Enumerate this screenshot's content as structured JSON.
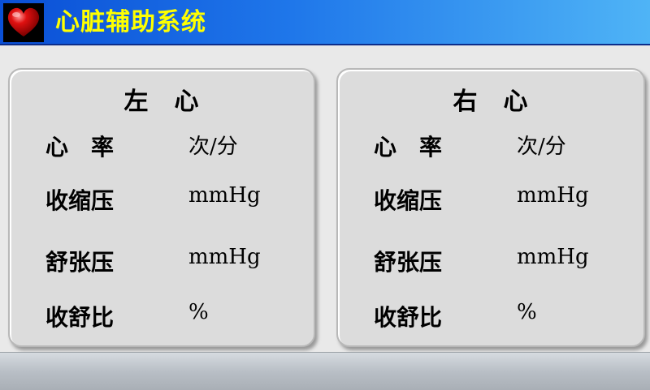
{
  "header": {
    "title": "心脏辅助系统",
    "logo_icon": "heart-icon"
  },
  "colors": {
    "title_text": "#ffff00",
    "titlebar_start": "#0a4fd6",
    "titlebar_end": "#4fb4f6"
  },
  "left_panel": {
    "title": "左　心",
    "rows": [
      {
        "label": "心　率",
        "unit": "次/分"
      },
      {
        "label": "收缩压",
        "unit": "mmHg"
      },
      {
        "label": "舒张压",
        "unit": "mmHg"
      },
      {
        "label": "收舒比",
        "unit": "%"
      }
    ]
  },
  "right_panel": {
    "title": "右　心",
    "rows": [
      {
        "label": "心　率",
        "unit": "次/分"
      },
      {
        "label": "收缩压",
        "unit": "mmHg"
      },
      {
        "label": "舒张压",
        "unit": "mmHg"
      },
      {
        "label": "收舒比",
        "unit": "%"
      }
    ]
  }
}
